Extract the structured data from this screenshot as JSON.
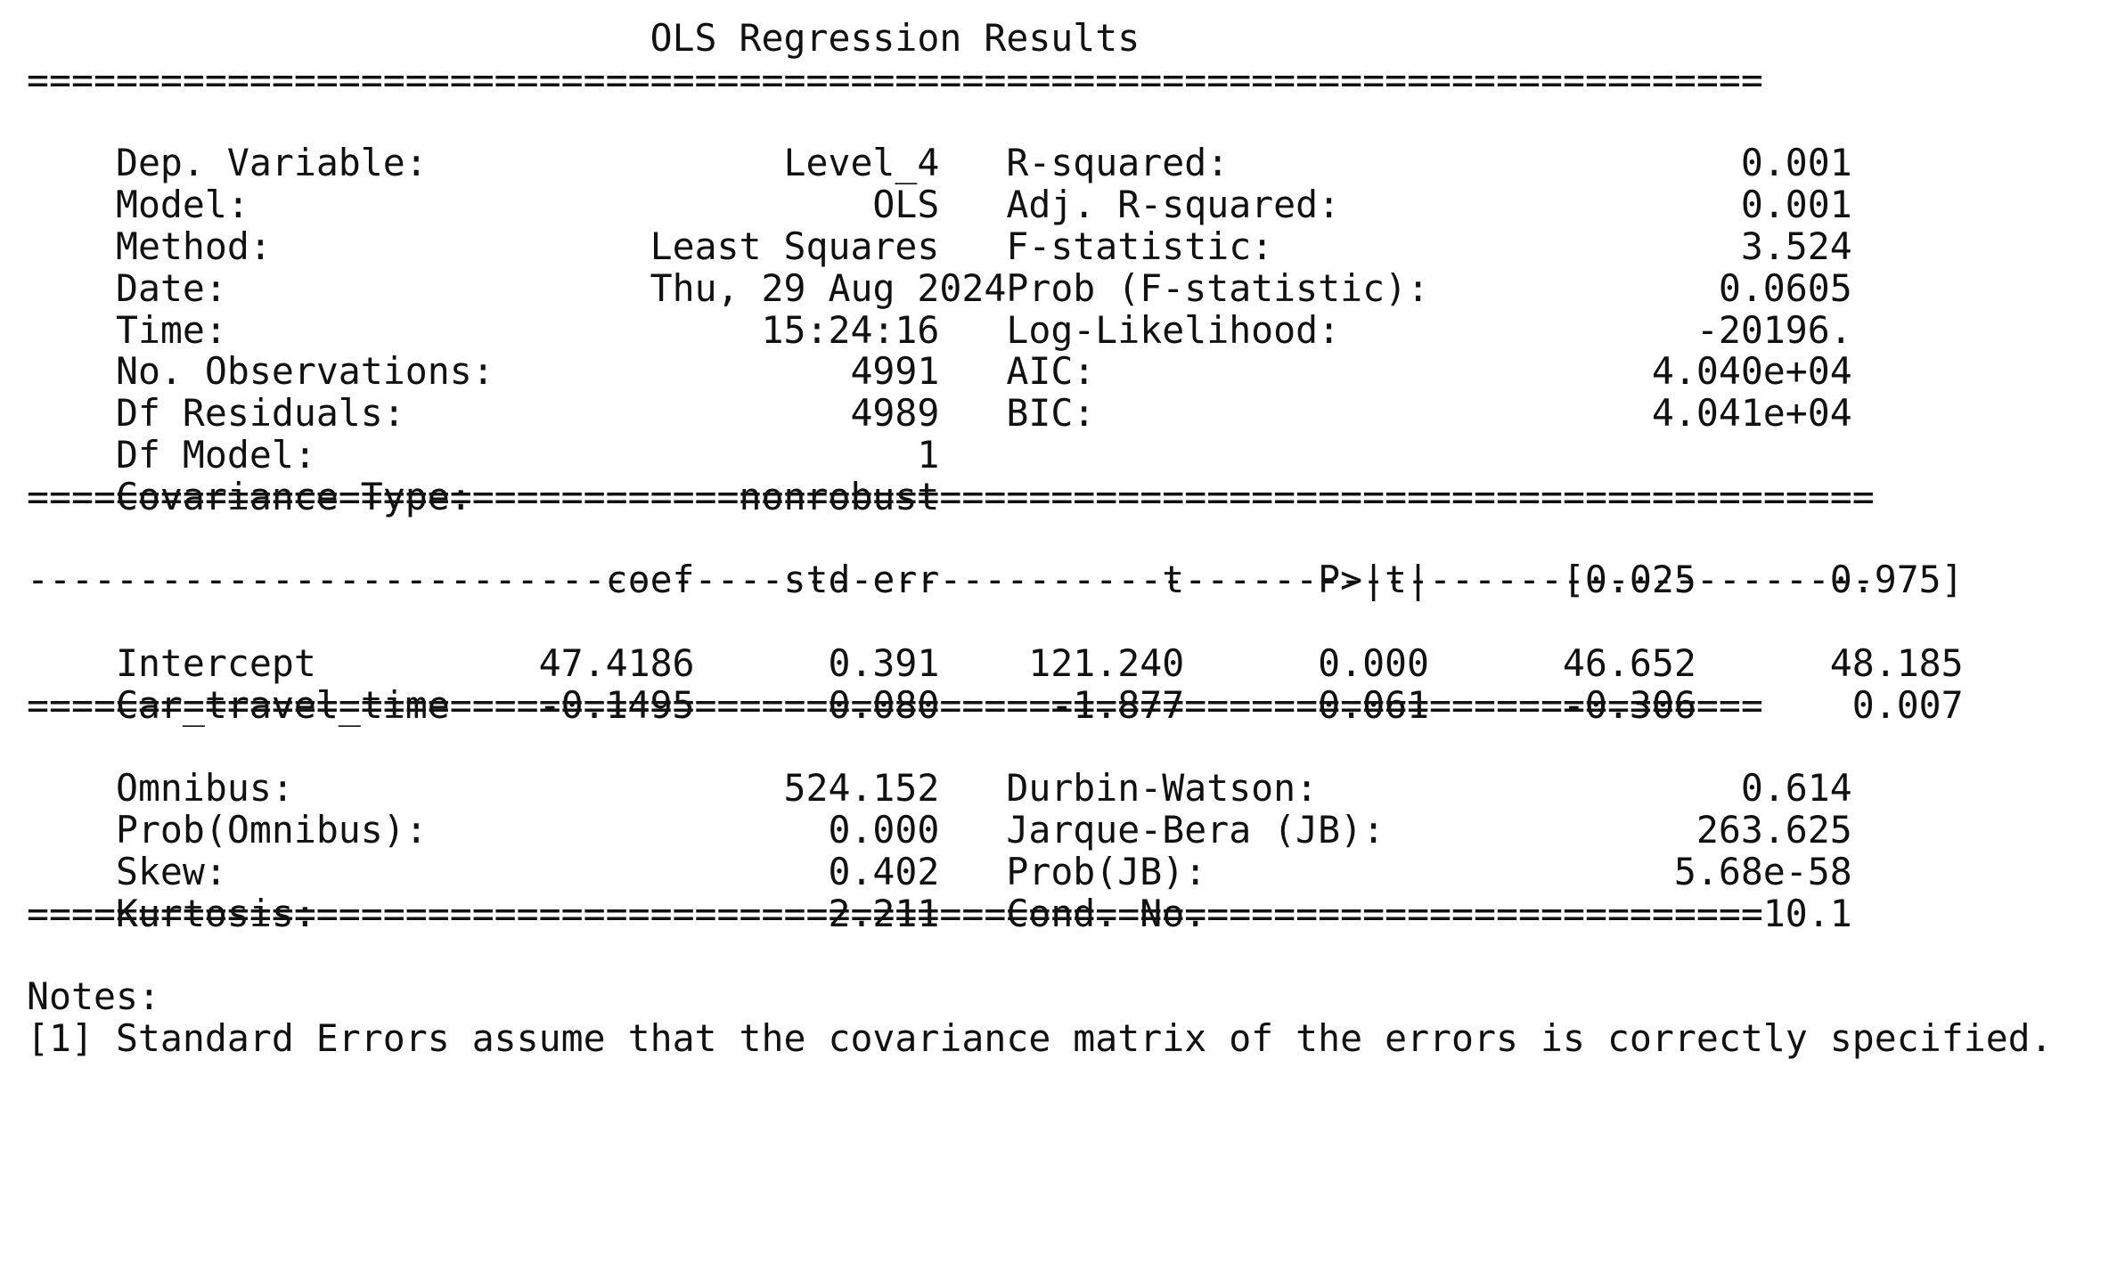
{
  "title": "OLS Regression Results",
  "rule_eq_78": "==============================================================================",
  "rule_eq_83": "===================================================================================",
  "rule_dash_83": "-----------------------------------------------------------------------------------",
  "summary": {
    "left": [
      {
        "label": "Dep. Variable:",
        "value": "Level_4"
      },
      {
        "label": "Model:",
        "value": "OLS"
      },
      {
        "label": "Method:",
        "value": "Least Squares"
      },
      {
        "label": "Date:",
        "value": "Thu, 29 Aug 2024"
      },
      {
        "label": "Time:",
        "value": "15:24:16"
      },
      {
        "label": "No. Observations:",
        "value": "4991"
      },
      {
        "label": "Df Residuals:",
        "value": "4989"
      },
      {
        "label": "Df Model:",
        "value": "1"
      },
      {
        "label": "Covariance Type:",
        "value": "nonrobust"
      }
    ],
    "right": [
      {
        "label": "R-squared:",
        "value": "0.001"
      },
      {
        "label": "Adj. R-squared:",
        "value": "0.001"
      },
      {
        "label": "F-statistic:",
        "value": "3.524"
      },
      {
        "label": "Prob (F-statistic):",
        "value": "0.0605"
      },
      {
        "label": "Log-Likelihood:",
        "value": "-20196."
      },
      {
        "label": "AIC:",
        "value": "4.040e+04"
      },
      {
        "label": "BIC:",
        "value": "4.041e+04"
      }
    ]
  },
  "coef_table": {
    "headers": [
      "coef",
      "std err",
      "t",
      "P>|t|",
      "[0.025",
      "0.975]"
    ],
    "rows": [
      {
        "name": "Intercept",
        "values": [
          "47.4186",
          "0.391",
          "121.240",
          "0.000",
          "46.652",
          "48.185"
        ]
      },
      {
        "name": "Car_travel_time",
        "values": [
          "-0.1495",
          "0.080",
          "-1.877",
          "0.061",
          "-0.306",
          "0.007"
        ]
      }
    ]
  },
  "diagnostics": {
    "left": [
      {
        "label": "Omnibus:",
        "value": "524.152"
      },
      {
        "label": "Prob(Omnibus):",
        "value": "0.000"
      },
      {
        "label": "Skew:",
        "value": "0.402"
      },
      {
        "label": "Kurtosis:",
        "value": "2.211"
      }
    ],
    "right": [
      {
        "label": "Durbin-Watson:",
        "value": "0.614"
      },
      {
        "label": "Jarque-Bera (JB):",
        "value": "263.625"
      },
      {
        "label": "Prob(JB):",
        "value": "5.68e-58"
      },
      {
        "label": "Cond. No.",
        "value": "10.1"
      }
    ]
  },
  "notes": {
    "heading": "Notes:",
    "items": [
      "[1] Standard Errors assume that the covariance matrix of the errors is correctly specified."
    ]
  }
}
